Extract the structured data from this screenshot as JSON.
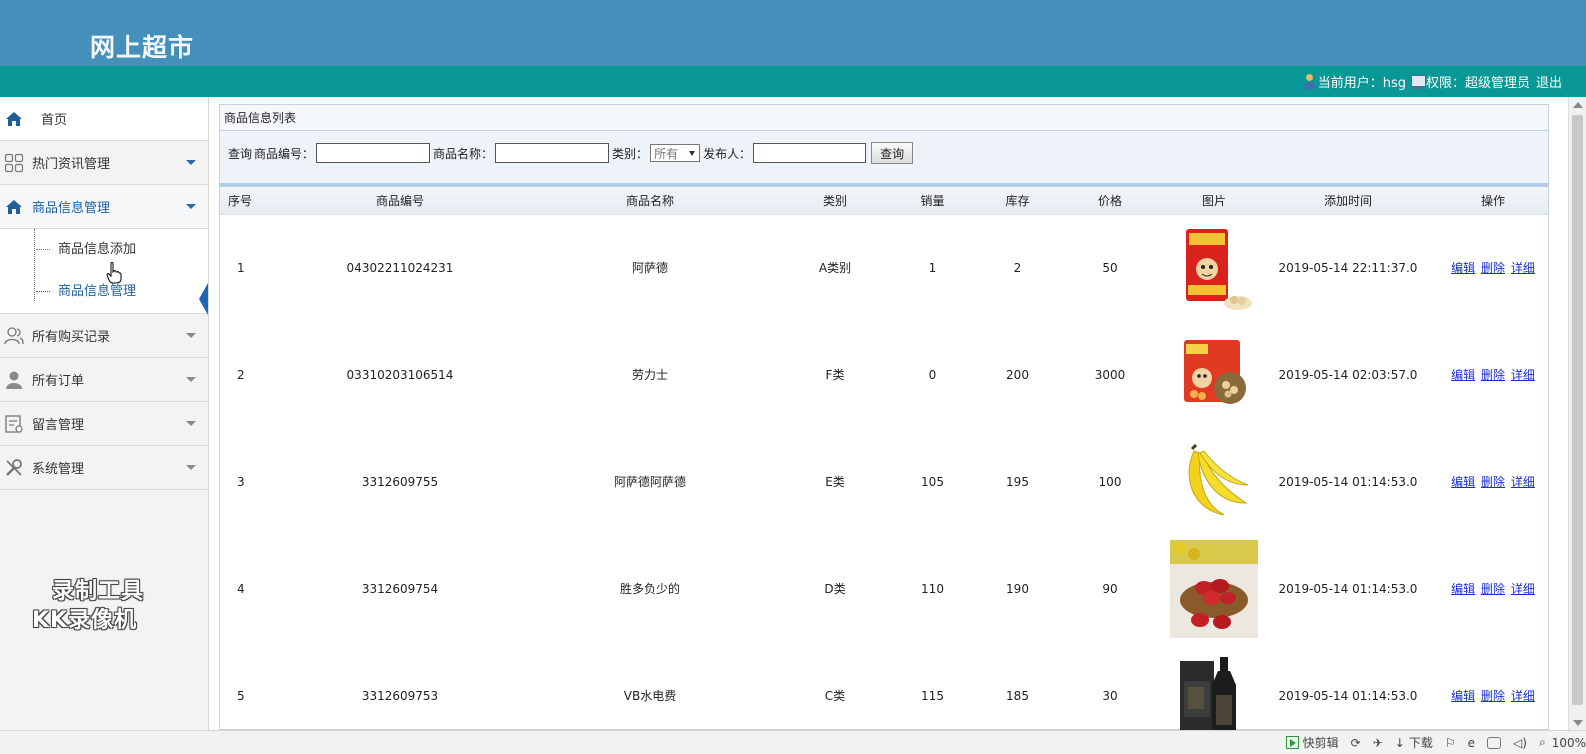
{
  "header": {
    "site_title": "网上超市"
  },
  "userbar": {
    "user_label": "当前用户：hsg",
    "permission_label": "权限：超级管理员",
    "logout_label": "退出"
  },
  "sidebar": {
    "home": "首页",
    "menus": [
      {
        "label": "热门资讯管理",
        "icon": "grid-icon"
      },
      {
        "label": "商品信息管理",
        "icon": "home-icon"
      },
      {
        "label": "所有购买记录",
        "icon": "users-icon"
      },
      {
        "label": "所有订单",
        "icon": "person-icon"
      },
      {
        "label": "留言管理",
        "icon": "form-icon"
      },
      {
        "label": "系统管理",
        "icon": "tools-icon"
      }
    ],
    "submenu": [
      {
        "label": "商品信息添加"
      },
      {
        "label": "商品信息管理"
      }
    ],
    "watermark_line1": "录制工具",
    "watermark_line2": "KK录像机"
  },
  "panel": {
    "title": "商品信息列表",
    "search": {
      "prefix": "查询",
      "code_label": "商品编号：",
      "code_value": "",
      "name_label": "商品名称：",
      "name_value": "",
      "category_label": "类别：",
      "category_selected": "所有",
      "publisher_label": "发布人：",
      "publisher_value": "",
      "button": "查询"
    },
    "table": {
      "columns": [
        "序号",
        "商品编号",
        "商品名称",
        "类别",
        "销量",
        "库存",
        "价格",
        "图片",
        "添加时间",
        "操作"
      ],
      "rows": [
        {
          "no": "1",
          "code": "04302211024231",
          "name": "阿萨德",
          "category": "A类别",
          "sales": "1",
          "stock": "2",
          "price": "50",
          "image": "snack-bag-image",
          "time": "2019-05-14 22:11:37.0"
        },
        {
          "no": "2",
          "code": "03310203106514",
          "name": "劳力士",
          "category": "F类",
          "sales": "0",
          "stock": "200",
          "price": "3000",
          "image": "snack-bag-image",
          "time": "2019-05-14 02:03:57.0"
        },
        {
          "no": "3",
          "code": "3312609755",
          "name": "阿萨德阿萨德",
          "category": "E类",
          "sales": "105",
          "stock": "195",
          "price": "100",
          "image": "banana-image",
          "time": "2019-05-14 01:14:53.0"
        },
        {
          "no": "4",
          "code": "3312609754",
          "name": "胜多负少的",
          "category": "D类",
          "sales": "110",
          "stock": "190",
          "price": "90",
          "image": "red-dates-image",
          "time": "2019-05-14 01:14:53.0"
        },
        {
          "no": "5",
          "code": "3312609753",
          "name": "VB水电费",
          "category": "C类",
          "sales": "115",
          "stock": "185",
          "price": "30",
          "image": "liquor-bottle-image",
          "time": "2019-05-14 01:14:53.0"
        }
      ],
      "ops": {
        "edit": "编辑",
        "delete": "删除",
        "detail": "详细"
      }
    }
  },
  "statusbar": {
    "quick_edit": "快剪辑",
    "download": "下载",
    "zoom": "100%"
  },
  "colors": {
    "banner": "#4590bb",
    "userbar": "#099896",
    "link": "#1a2fd0",
    "active_menu": "#1b5fa3"
  }
}
